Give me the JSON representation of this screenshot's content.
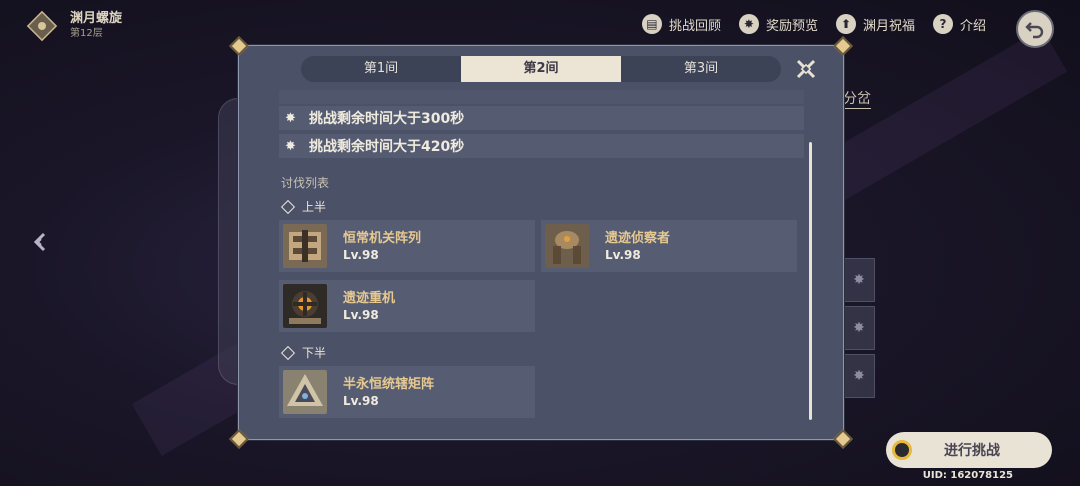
{
  "header": {
    "title": "渊月螺旋",
    "floor": "第12层"
  },
  "topnav": [
    {
      "label": "挑战回顾",
      "icon": "book-icon"
    },
    {
      "label": "奖励预览",
      "icon": "reward-icon"
    },
    {
      "label": "渊月祝福",
      "icon": "blessing-icon"
    },
    {
      "label": "介绍",
      "icon": "help-icon"
    }
  ],
  "background": {
    "right_tab": "分岔"
  },
  "modal": {
    "tabs": [
      "第1间",
      "第2间",
      "第3间"
    ],
    "active_tab": 1,
    "conditions": [
      "挑战剩余时间大于300秒",
      "挑战剩余时间大于420秒"
    ],
    "enemy_list_title": "讨伐列表",
    "first_half_label": "上半",
    "second_half_label": "下半",
    "first_half": [
      {
        "name": "恒常机关阵列",
        "level": "Lv.98"
      },
      {
        "name": "遗迹侦察者",
        "level": "Lv.98"
      },
      {
        "name": "遗迹重机",
        "level": "Lv.98"
      }
    ],
    "second_half": [
      {
        "name": "半永恒统辖矩阵",
        "level": "Lv.98"
      }
    ]
  },
  "challenge_button": "进行挑战",
  "uid": "UID: 162078125",
  "colors": {
    "modal_bg": "#4b5166",
    "accent_gold": "#e6c990",
    "tab_active": "#ece5d6"
  }
}
